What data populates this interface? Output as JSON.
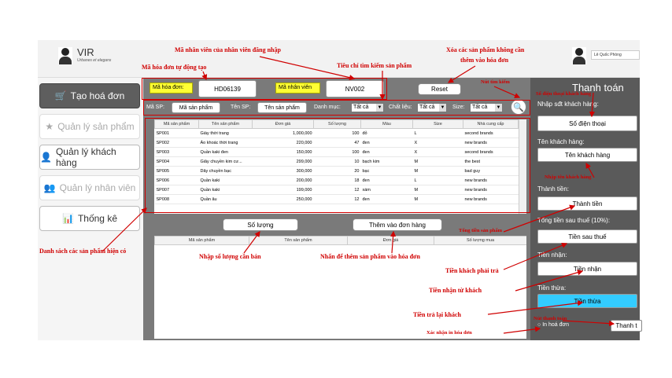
{
  "app": {
    "title": "VIR",
    "subtitle": "Urbanes et elegans",
    "user": "Lê Quốc Phòng"
  },
  "sidebar": {
    "items": [
      {
        "label": "Tạo hoá đơn",
        "icon": "cart-icon"
      },
      {
        "label": "Quản lý sản phẩm",
        "icon": "star-icon"
      },
      {
        "label": "Quản lý khách hàng",
        "icon": "person-icon"
      },
      {
        "label": "Quản lý nhân viên",
        "icon": "group-icon"
      },
      {
        "label": "Thống kê",
        "icon": "report-icon"
      }
    ]
  },
  "header": {
    "invoice_label": "Mã hóa đơn:",
    "invoice_value": "HD06139",
    "staff_label": "Mã nhân viên",
    "staff_value": "NV002",
    "reset_label": "Reset"
  },
  "filters": {
    "code_label": "Mã SP:",
    "code_value": "Mã sản phẩm",
    "name_label": "Tên SP:",
    "name_value": "Tên sản phẩm",
    "category_label": "Danh mục:",
    "category_value": "Tất cả",
    "material_label": "Chất liệu:",
    "material_value": "Tất cả",
    "size_label": "Size:",
    "size_value": "Tất cả"
  },
  "products": {
    "columns": [
      "Mã sản phẩm",
      "Tên sản phẩm",
      "Đơn giá",
      "Số lượng",
      "Màu",
      "Size",
      "Nhà cung cấp"
    ],
    "rows": [
      [
        "SP001",
        "Giày thời trang",
        "1,000,000",
        "100",
        "đỏ",
        "L",
        "second brands"
      ],
      [
        "SP002",
        "Áo khoác thời trang",
        "220,000",
        "47",
        "đen",
        "X",
        "new brands"
      ],
      [
        "SP003",
        "Quần kaki đen",
        "150,000",
        "100",
        "đen",
        "X",
        "second brands"
      ],
      [
        "SP004",
        "Giây chuyền kim cư...",
        "299,000",
        "10",
        "bạch kim",
        "M",
        "the best"
      ],
      [
        "SP005",
        "Dây chuyền bạc",
        "300,000",
        "20",
        "bạc",
        "M",
        "bad guy"
      ],
      [
        "SP006",
        "Quần kaki",
        "200,000",
        "18",
        "đen",
        "L",
        "new brands"
      ],
      [
        "SP007",
        "Quần kaki",
        "199,000",
        "12",
        "xám",
        "M",
        "new brands"
      ],
      [
        "SP008",
        "Quần âu",
        "250,000",
        "12",
        "đen",
        "M",
        "new brands"
      ]
    ]
  },
  "actions": {
    "qty_label": "Số lượng",
    "add_label": "Thêm vào đơn hàng"
  },
  "order": {
    "columns": [
      "Mã sản phẩm",
      "Tên sản phẩm",
      "Đơn giá",
      "Số lượng mua"
    ]
  },
  "payment": {
    "title": "Thanh toán",
    "phone_label": "Nhập sđt khách hàng:",
    "phone_value": "Số điện thoại",
    "name_label": "Tên khách hàng:",
    "name_value": "Tên khách hàng",
    "total_label": "Thành tiền:",
    "total_value": "Thành tiền",
    "after_tax_label": "Tổng tiền sau thuế (10%):",
    "after_tax_value": "Tiền sau thuế",
    "received_label": "Tiền nhận:",
    "received_value": "Tiền nhận",
    "change_label": "Tiền thừa:",
    "change_value": "Tiền thừa",
    "print_label": "In hoá đơn",
    "pay_label": "Thanh t",
    "change_color": "#33ccff"
  },
  "annotations": {
    "a1": "Mã  nhân viên của nhân viên đăng nhập",
    "a2": "Mã hóa đơn tự động tạo",
    "a3": "Tiêu chí tìm kiếm sản phẩm",
    "a4": "Xóa các sản phẩm không cần",
    "a4b": "thêm vào hóa đơn",
    "a5": "Nút tìm kiếm",
    "a6": "Số điện thoại khách hàng",
    "a7": "Nhập tên khách hàng",
    "a8": "Tổng tiền sản phẩm",
    "a9": "Danh sách các sản phẩm hiện có",
    "a10": "Nhập số lượng cần bán",
    "a11": "Nhấn để thêm sản phẩm vào hóa đơn",
    "a12": "Tiền khách phải trả",
    "a13": "Tiền nhận từ khách",
    "a14": "Tiền trả lại khách",
    "a15": "Nút thanh toán",
    "a16": "Xác nhận in hóa đơn"
  }
}
